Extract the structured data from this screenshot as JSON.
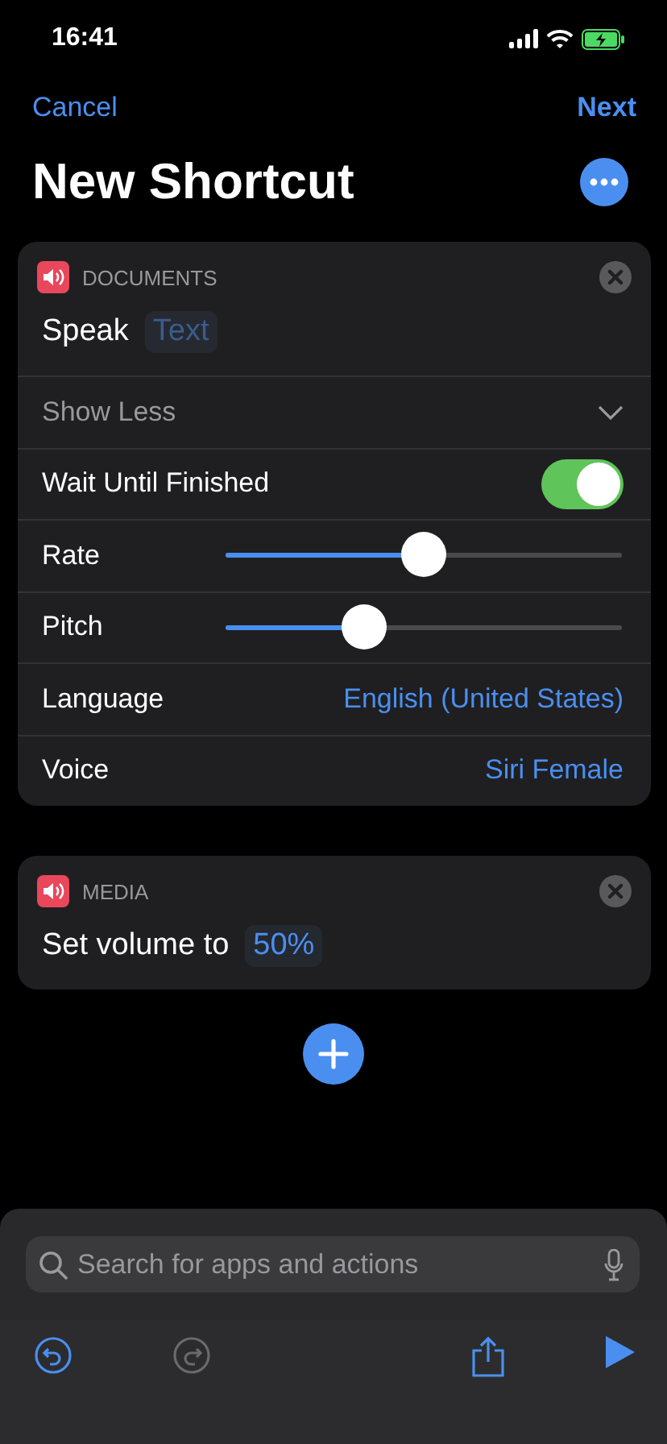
{
  "status_bar": {
    "time": "16:41"
  },
  "nav": {
    "cancel": "Cancel",
    "next": "Next",
    "title": "New Shortcut"
  },
  "actions": [
    {
      "category": "DOCUMENTS",
      "title": "Speak",
      "parameter": "Text",
      "filled": false,
      "toggle": {
        "label": "Show Less",
        "expanded": true
      },
      "options": [
        {
          "kind": "toggle",
          "label": "Wait Until Finished",
          "on": true
        },
        {
          "kind": "slider",
          "label": "Rate",
          "level": 0.5
        },
        {
          "kind": "slider",
          "label": "Pitch",
          "level": 0.35
        },
        {
          "kind": "value",
          "label": "Language",
          "value": "English (United States)"
        },
        {
          "kind": "value",
          "label": "Voice",
          "value": "Siri Female"
        }
      ]
    },
    {
      "category": "MEDIA",
      "title": "Set volume to",
      "parameter": "50%",
      "filled": true
    }
  ],
  "search": {
    "placeholder": "Search for apps and actions"
  },
  "toolbar": {
    "undo_disabled": false,
    "redo_disabled": true
  }
}
